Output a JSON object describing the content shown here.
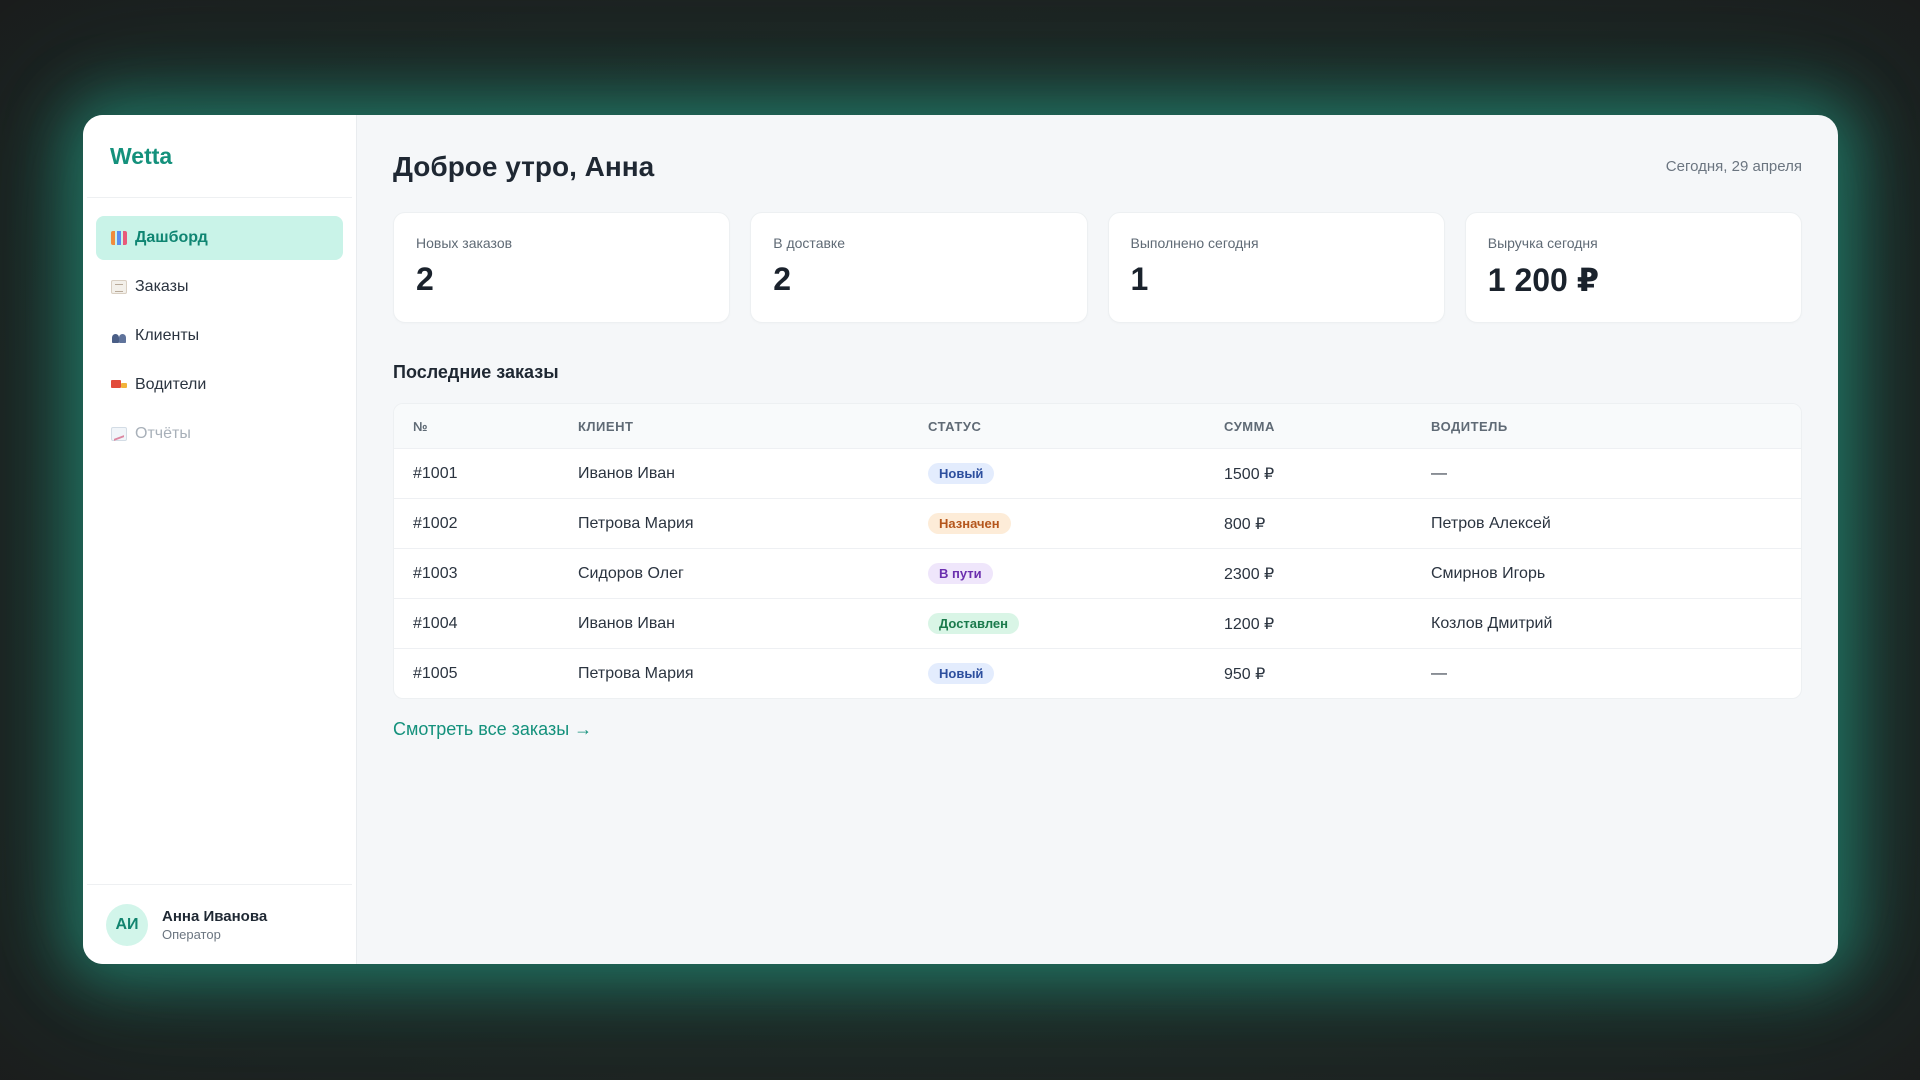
{
  "app": {
    "name": "Wetta"
  },
  "sidebar": {
    "items": [
      {
        "label": "Дашборд",
        "icon": "bar-chart-icon",
        "active": true
      },
      {
        "label": "Заказы",
        "icon": "clipboard-icon"
      },
      {
        "label": "Клиенты",
        "icon": "people-icon"
      },
      {
        "label": "Водители",
        "icon": "truck-icon"
      },
      {
        "label": "Отчёты",
        "icon": "chart-report-icon",
        "muted": true
      }
    ],
    "user": {
      "initials": "АИ",
      "name": "Анна Иванова",
      "role": "Оператор"
    }
  },
  "header": {
    "title": "Доброе утро, Анна",
    "date": "Сегодня, 29 апреля"
  },
  "stats": [
    {
      "label": "Новых заказов",
      "value": "2"
    },
    {
      "label": "В доставке",
      "value": "2"
    },
    {
      "label": "Выполнено сегодня",
      "value": "1"
    },
    {
      "label": "Выручка сегодня",
      "value": "1 200 ₽"
    }
  ],
  "orders": {
    "title": "Последние заказы",
    "columns": [
      "№",
      "КЛИЕНТ",
      "СТАТУС",
      "СУММА",
      "ВОДИТЕЛЬ"
    ],
    "rows": [
      {
        "id": "#1001",
        "client": "Иванов Иван",
        "status": "Новый",
        "status_bg": "#e3ecfd",
        "status_color": "#2d4f9e",
        "amount": "1500 ₽",
        "driver": "—"
      },
      {
        "id": "#1002",
        "client": "Петрова Мария",
        "status": "Назначен",
        "status_bg": "#fdecd8",
        "status_color": "#b5561c",
        "amount": "800 ₽",
        "driver": "Петров Алексей"
      },
      {
        "id": "#1003",
        "client": "Сидоров Олег",
        "status": "В пути",
        "status_bg": "#efe6fb",
        "status_color": "#6b2fae",
        "amount": "2300 ₽",
        "driver": "Смирнов Игорь"
      },
      {
        "id": "#1004",
        "client": "Иванов Иван",
        "status": "Доставлен",
        "status_bg": "#d9f5e6",
        "status_color": "#1b7a4c",
        "amount": "1200 ₽",
        "driver": "Козлов Дмитрий"
      },
      {
        "id": "#1005",
        "client": "Петрова Мария",
        "status": "Новый",
        "status_bg": "#e3ecfd",
        "status_color": "#2d4f9e",
        "amount": "950 ₽",
        "driver": "—"
      }
    ],
    "view_all": "Смотреть все заказы →"
  },
  "colors": {
    "accent": "#14917c",
    "active_bg": "#c9f3e8"
  }
}
